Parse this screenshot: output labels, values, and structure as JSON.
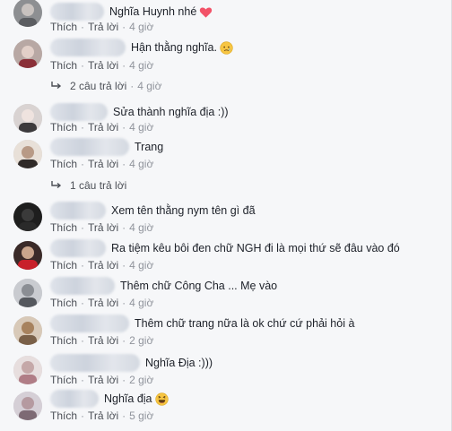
{
  "comments": [
    {
      "text": "Nghĩa Huynh nhé",
      "emoji": "heart-emoji",
      "time": "4 giờ"
    },
    {
      "text": "Hận thằng nghĩa.",
      "emoji": "crying-emoji",
      "time": "4 giờ"
    },
    {
      "text": "Sửa thành nghĩa địa :))",
      "time": "4 giờ"
    },
    {
      "text": "Trang",
      "time": "4 giờ"
    },
    {
      "text": "Xem tên thằng nym tên gì đã",
      "time": "4 giờ"
    },
    {
      "text": "Ra tiệm kêu bôi đen chữ NGH đi là mọi thứ sẽ đâu vào đó",
      "time": "4 giờ"
    },
    {
      "text": "Thêm chữ Công Cha ... Mẹ vào",
      "time": "4 giờ"
    },
    {
      "text": "Thêm chữ trang nữa là ok chứ cứ phải hỏi à",
      "time": "2 giờ"
    },
    {
      "text": "Nghĩa Địa :)))",
      "time": "2 giờ"
    },
    {
      "text": "Nghĩa địa",
      "emoji": "laughing-emoji",
      "time": "5 giờ"
    }
  ],
  "actions": {
    "like": "Thích",
    "reply": "Trả lời",
    "dot": "·"
  },
  "reply_threads": [
    {
      "label": "2 câu trả lời",
      "time": "4 giờ"
    },
    {
      "label": "1 câu trả lời"
    }
  ],
  "colors": {
    "background": "#f6f7f9",
    "text": "#1d2129",
    "secondary": "#4b4f56",
    "muted": "#90949c",
    "heart": "#f25268"
  }
}
